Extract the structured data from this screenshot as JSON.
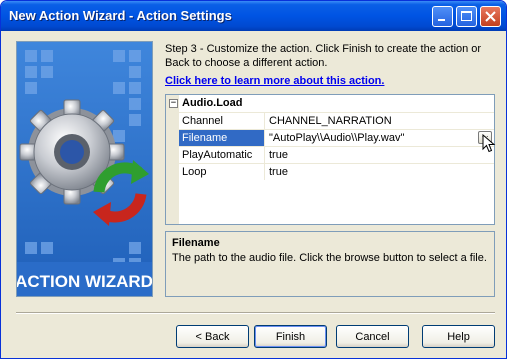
{
  "window": {
    "title": "New Action Wizard - Action Settings"
  },
  "art": {
    "label": "ACTION WIZARD"
  },
  "instructions": "Step 3 - Customize the action.  Click Finish to create the action or Back to choose a different action.",
  "learn_link": "Click here to learn more about this action.",
  "grid": {
    "category": "Audio.Load",
    "toggle": "−",
    "rows": [
      {
        "name": "Channel",
        "value": "CHANNEL_NARRATION"
      },
      {
        "name": "Filename",
        "value": "\"AutoPlay\\\\Audio\\\\Play.wav\""
      },
      {
        "name": "PlayAutomatic",
        "value": "true"
      },
      {
        "name": "Loop",
        "value": "true"
      }
    ],
    "browse_label": "..."
  },
  "description": {
    "title": "Filename",
    "text": "The path to the audio file. Click the browse button to select a file."
  },
  "buttons": {
    "back": "< Back",
    "finish": "Finish",
    "cancel": "Cancel",
    "help": "Help"
  },
  "colors": {
    "title_bar": "#0054e3",
    "selection": "#316ac5",
    "link": "#0000ee",
    "art_blue": "#3a7bd5"
  },
  "icons": [
    "minimize-icon",
    "maximize-icon",
    "close-icon",
    "gear-icon",
    "refresh-arrow-icon",
    "mouse-cursor-icon"
  ]
}
